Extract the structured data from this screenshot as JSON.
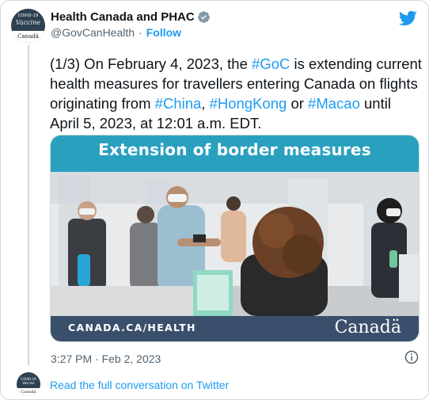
{
  "author": {
    "name": "Health Canada and PHAC",
    "handle": "@GovCanHealth",
    "separator": "·",
    "follow_label": "Follow",
    "avatar": {
      "top_text": "COVID-19",
      "mid_text": "Vaccine",
      "bottom_text": "Canadä"
    }
  },
  "icons": {
    "verified": "verified-badge-icon",
    "twitter": "twitter-bird-icon",
    "info": "info-icon"
  },
  "tweet": {
    "text_parts": {
      "p1": "(1/3) On February 4, 2023, the ",
      "h1": "#GoC",
      "p2": " is extending current health measures for travellers entering Canada on flights originating from ",
      "h2": "#China",
      "p3": ", ",
      "h3": "#HongKong",
      "p4": " or ",
      "h4": "#Macao",
      "p5": " until April 5, 2023, at 12:01 a.m. EDT."
    },
    "timestamp": "3:27 PM · Feb 2, 2023"
  },
  "media": {
    "title": "Extension of border measures",
    "url_text": "CANADA.CA/HEALTH",
    "wordmark": "Canadä"
  },
  "footer": {
    "read_more": "Read the full conversation on Twitter",
    "avatar_top": "COVID-19 Vaccine",
    "avatar_bottom": "Canadä"
  },
  "colors": {
    "link": "#1d9bf0",
    "text": "#0f1419",
    "muted": "#536471",
    "banner_teal": "#2aa0bf",
    "footer_navy": "#3a4f6b",
    "avatar_bg": "#2e4152"
  }
}
